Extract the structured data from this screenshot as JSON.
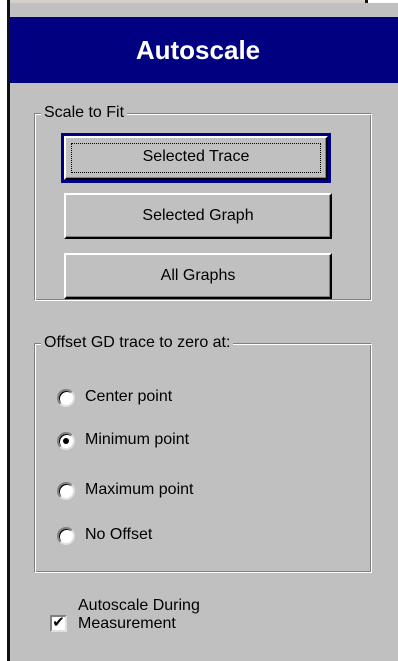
{
  "panel": {
    "title": "Autoscale",
    "colors": {
      "title_bg": "#000080",
      "title_text": "#ffffff",
      "panel_bg": "#c0c0c0"
    }
  },
  "scale_to_fit": {
    "label": "Scale to Fit",
    "buttons": {
      "selected_trace": "Selected Trace",
      "selected_graph": "Selected Graph",
      "all_graphs": "All Graphs"
    },
    "default_button": "selected_trace"
  },
  "offset_group": {
    "label": "Offset GD trace to zero at:",
    "options": [
      {
        "label": "Center point",
        "selected": false
      },
      {
        "label": "Minimum point",
        "selected": true
      },
      {
        "label": "Maximum point",
        "selected": false
      },
      {
        "label": "No Offset",
        "selected": false
      }
    ]
  },
  "autoscale_checkbox": {
    "line1": "Autoscale During",
    "line2": "Measurement",
    "checked": true
  }
}
